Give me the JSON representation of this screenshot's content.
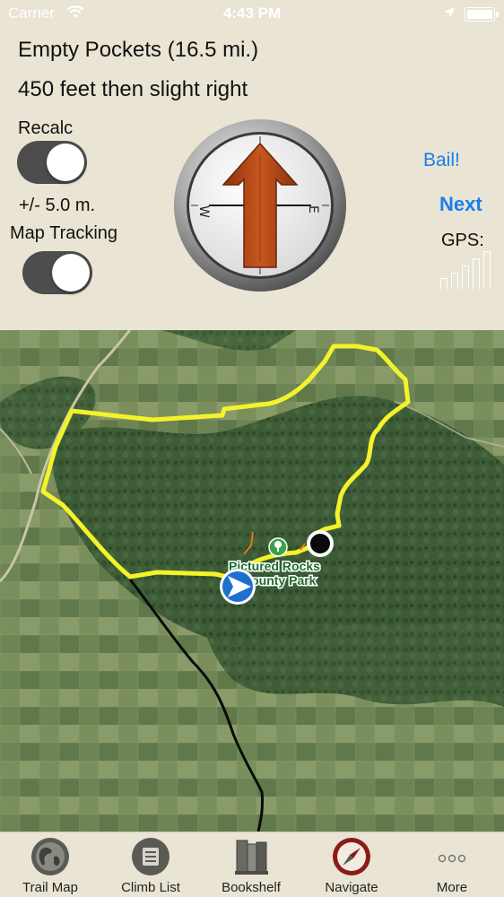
{
  "status_bar": {
    "carrier": "Carrier",
    "time": "4:43 PM"
  },
  "route": {
    "title": "Empty Pockets (16.5 mi.)",
    "instruction": "450 feet then slight right"
  },
  "controls": {
    "recalc_label": "Recalc",
    "recalc_on": true,
    "accuracy": "+/- 5.0 m.",
    "map_tracking_label": "Map Tracking",
    "map_tracking_on": true,
    "bail_label": "Bail!",
    "next_label": "Next",
    "gps_label": "GPS:",
    "gps_signal_bars": 5
  },
  "compass": {
    "west_label": "W",
    "east_label": "E"
  },
  "map": {
    "park_label_line1": "Pictured Rocks",
    "park_label_line2": "County Park",
    "route_color": "#f4f22a",
    "track_color": "#0a0a0a"
  },
  "tabs": [
    {
      "label": "Trail Map",
      "icon": "globe-icon"
    },
    {
      "label": "Climb List",
      "icon": "list-icon"
    },
    {
      "label": "Bookshelf",
      "icon": "books-icon"
    },
    {
      "label": "Navigate",
      "icon": "compass-icon",
      "active": true
    },
    {
      "label": "More",
      "icon": "more-icon"
    }
  ],
  "colors": {
    "accent": "#1a7ef0",
    "background": "#e9e4d3",
    "arrow": "#b5481c",
    "active_tab": "#8b1a1a"
  }
}
